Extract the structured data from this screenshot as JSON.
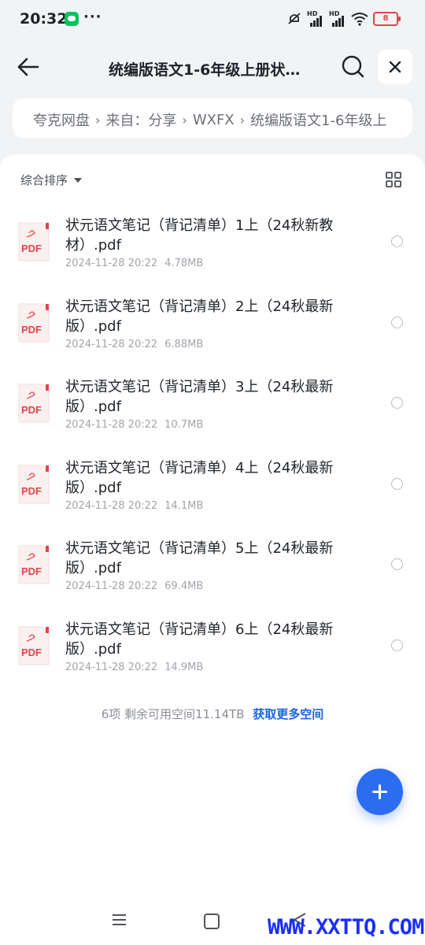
{
  "status_bar": {
    "time": "20:32",
    "more": "···",
    "hd1": "HD",
    "hd2": "HD",
    "battery": "8"
  },
  "header": {
    "title": "统编版语文1-6年级上册状…"
  },
  "breadcrumb": {
    "items": [
      "夸克网盘",
      "来自：分享",
      "WXFX",
      "统编版语文1-6年级上"
    ]
  },
  "toolbar": {
    "sort_label": "综合排序"
  },
  "files": [
    {
      "name": "状元语文笔记（背记清单）1上（24秋新教材）.pdf",
      "date": "2024-11-28 20:22",
      "size": "4.78MB",
      "icon": "PDF"
    },
    {
      "name": "状元语文笔记（背记清单）2上（24秋最新版）.pdf",
      "date": "2024-11-28 20:22",
      "size": "6.88MB",
      "icon": "PDF"
    },
    {
      "name": "状元语文笔记（背记清单）3上（24秋最新版）.pdf",
      "date": "2024-11-28 20:22",
      "size": "10.7MB",
      "icon": "PDF"
    },
    {
      "name": "状元语文笔记（背记清单）4上（24秋最新版）.pdf",
      "date": "2024-11-28 20:22",
      "size": "14.1MB",
      "icon": "PDF"
    },
    {
      "name": "状元语文笔记（背记清单）5上（24秋最新版）.pdf",
      "date": "2024-11-28 20:22",
      "size": "69.4MB",
      "icon": "PDF"
    },
    {
      "name": "状元语文笔记（背记清单）6上（24秋最新版）.pdf",
      "date": "2024-11-28 20:22",
      "size": "14.9MB",
      "icon": "PDF"
    }
  ],
  "footer": {
    "summary": "6项 剩余可用空间11.14TB",
    "more_space": "获取更多空间"
  },
  "watermark": "WWW.XXTTQ.COM",
  "colors": {
    "accent": "#2c6cf0",
    "link": "#1b63e8",
    "pdf_red": "#e0454a"
  }
}
